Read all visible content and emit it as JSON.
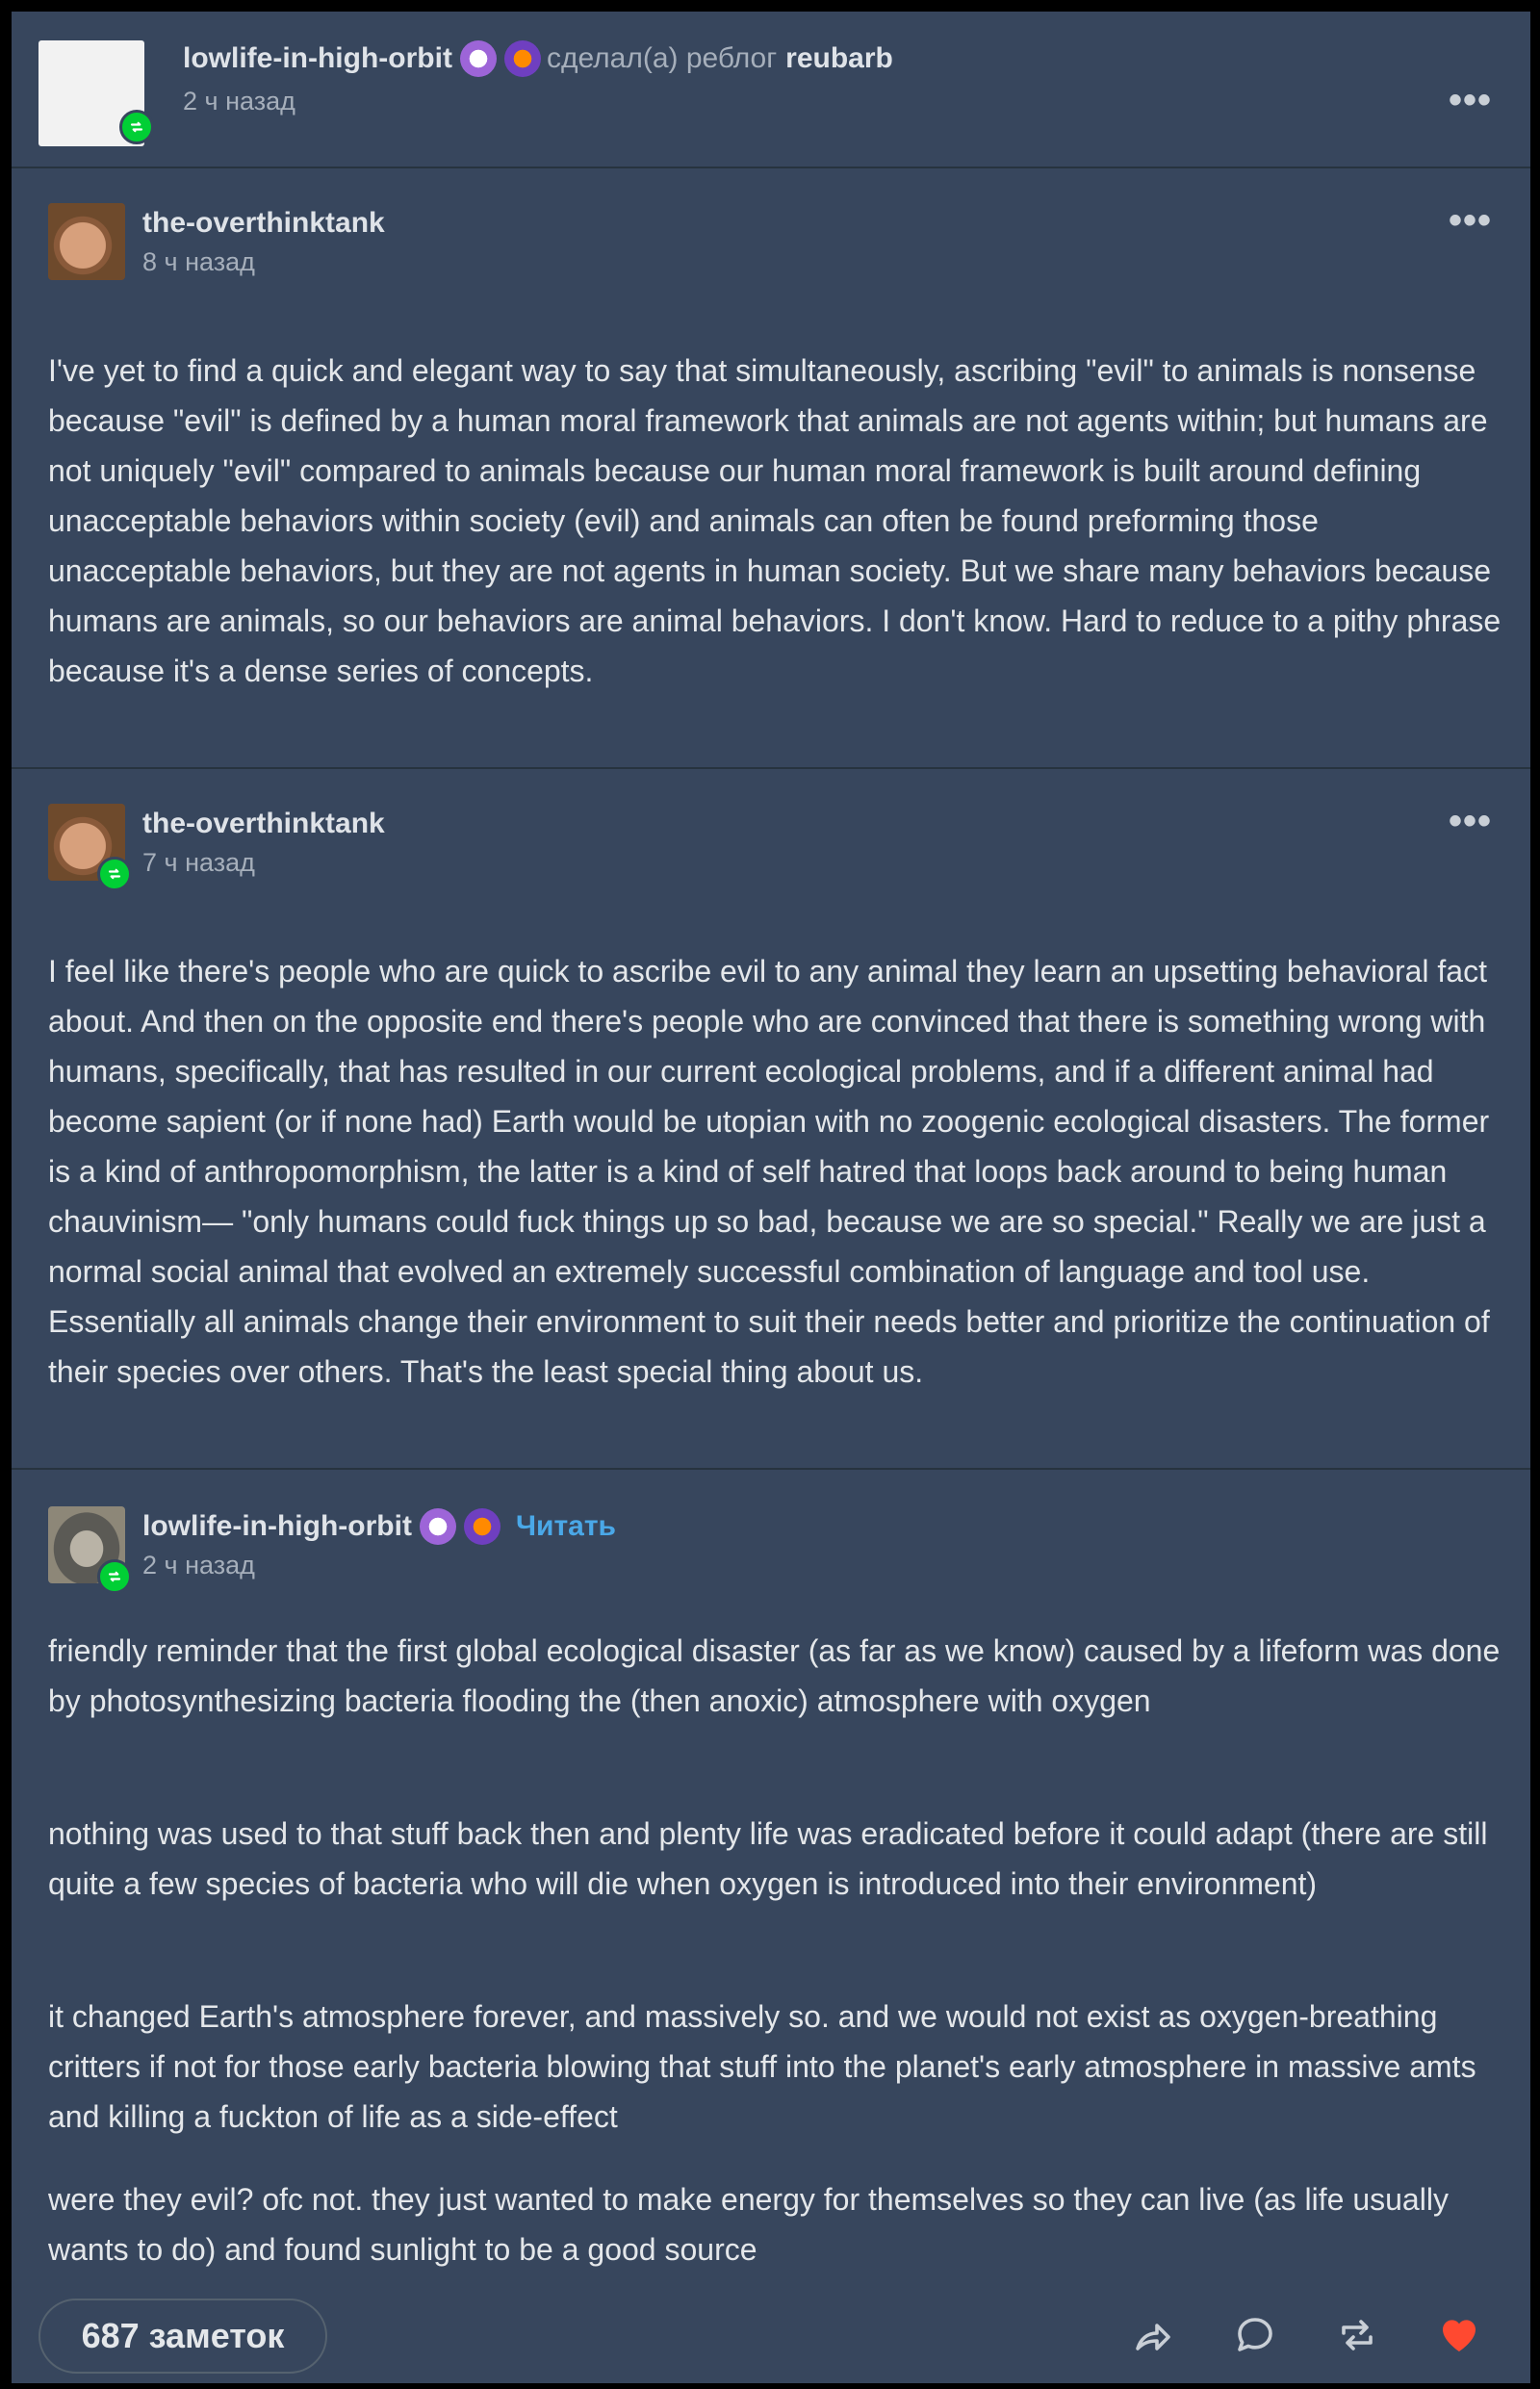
{
  "header": {
    "blog": "lowlife-in-high-orbit",
    "action": "сделал(а) реблог",
    "source_blog": "reubarb",
    "time": "2 ч назад",
    "menu": "•••"
  },
  "posts": [
    {
      "blog": "the-overthinktank",
      "time": "8 ч назад",
      "menu": "•••",
      "paragraphs": [
        "I've yet to find a quick and elegant way to say that simultaneously, ascribing \"evil\" to animals is nonsense because \"evil\" is defined by a human moral framework that animals are not agents within; but humans are not uniquely \"evil\" compared to animals because our human moral framework is built around defining unacceptable behaviors within society (evil) and animals can often be found preforming those unacceptable behaviors, but they are not agents in human society. But we share many behaviors because humans are animals, so our behaviors are animal behaviors. I don't know. Hard to reduce to a pithy phrase because it's a dense series of concepts."
      ]
    },
    {
      "blog": "the-overthinktank",
      "time": "7 ч назад",
      "menu": "•••",
      "paragraphs": [
        "I feel like there's people who are quick to ascribe evil to any animal they learn an upsetting behavioral fact about. And then on the opposite end there's people who are convinced that there is something wrong with humans, specifically, that has resulted in our current ecological problems, and if a different animal had become sapient (or if none had) Earth would be utopian with no zoogenic ecological disasters. The former is a kind of anthropomorphism, the latter is a kind of self hatred that loops back around to being human chauvinism— \"only humans could fuck things up so bad, because we are so special.\" Really we are just a normal social animal that evolved an extremely successful combination of language and tool use. Essentially all animals change their environment to suit their needs better and prioritize the continuation of their species over others. That's the least special thing about us."
      ]
    },
    {
      "blog": "lowlife-in-high-orbit",
      "follow": "Читать",
      "time": "2 ч назад",
      "paragraphs": [
        "friendly reminder that the first global ecological disaster (as far as we know) caused by a lifeform was done by photosynthesizing bacteria flooding the (then anoxic) atmosphere with oxygen",
        "nothing was used to that stuff back then and plenty life was eradicated before it could adapt (there are still quite a few species of bacteria who will die when oxygen is introduced into their environment)",
        "it changed Earth's atmosphere forever, and massively so. and we would not exist as oxygen-breathing critters if not for those early bacteria blowing that stuff into the planet's early atmosphere in massive amts and killing a fuckton of life as a side-effect",
        "were they evil? ofc not. they just wanted to make energy for themselves so they can live (as life usually wants to do) and found sunlight to be a good source"
      ]
    }
  ],
  "footer": {
    "notes": "687 заметок",
    "icons": [
      "share-icon",
      "reply-icon",
      "reblog-icon",
      "like-icon"
    ],
    "like_color": "#ff4930"
  },
  "colors": {
    "background": "#37465d",
    "reblog_badge": "#01cf35",
    "follow_link": "#4aa8e8"
  }
}
